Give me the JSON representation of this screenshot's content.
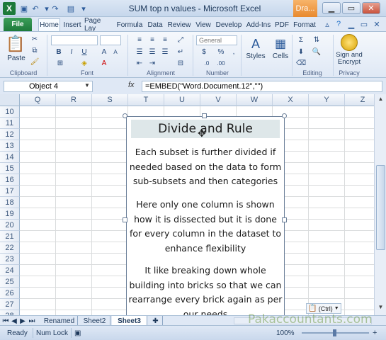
{
  "window": {
    "title": "SUM top n values - Microsoft Excel",
    "context_tab": "Dra...",
    "app_icon": "X"
  },
  "ribbon_tabs": [
    "File",
    "Home",
    "Insert",
    "Page Lay",
    "Formula",
    "Data",
    "Review",
    "View",
    "Develop",
    "Add-Ins",
    "PDF",
    "Format"
  ],
  "ribbon": {
    "clipboard": {
      "paste": "Paste",
      "label": "Clipboard"
    },
    "font": {
      "label": "Font",
      "bold": "B",
      "italic": "I",
      "underline": "U"
    },
    "alignment": {
      "label": "Alignment"
    },
    "number": {
      "label": "Number",
      "format": "General",
      "currency": "$",
      "percent": "%",
      "comma": ","
    },
    "styles": {
      "label": "Styles"
    },
    "cells": {
      "label": "Cells"
    },
    "editing": {
      "label": "Editing"
    },
    "privacy": {
      "label": "Privacy",
      "sign": "Sign and",
      "encrypt": "Encrypt"
    }
  },
  "formula_bar": {
    "name_box": "Object 4",
    "fx": "fx",
    "formula": "=EMBED(\"Word.Document.12\",\"\")"
  },
  "grid": {
    "columns": [
      "Q",
      "R",
      "S",
      "T",
      "U",
      "V",
      "W",
      "X",
      "Y",
      "Z"
    ],
    "rows": [
      "10",
      "11",
      "12",
      "13",
      "14",
      "15",
      "16",
      "17",
      "18",
      "19",
      "20",
      "21",
      "22",
      "23",
      "24",
      "25",
      "26",
      "27",
      "28"
    ]
  },
  "embedded_doc": {
    "title": "Divide and Rule",
    "paragraphs": [
      [
        "Each subset is further divided if",
        "needed based on the data to form",
        "sub-subsets and then categories"
      ],
      [
        "Here only one column is shown",
        "how it is dissected but it is done",
        "for every column in the dataset to",
        "enhance flexibility"
      ],
      [
        "It like breaking down whole",
        "building into bricks so that we can",
        "rearrange every brick again as per",
        "our needs"
      ]
    ]
  },
  "sheet_tabs": [
    "Renamed",
    "Sheet2",
    "Sheet3"
  ],
  "active_sheet": "Sheet3",
  "paste_options": "(Ctrl)",
  "status": {
    "mode": "Ready",
    "numlock": "Num Lock",
    "zoom": "100%"
  },
  "watermark": "Pakaccountants.com"
}
